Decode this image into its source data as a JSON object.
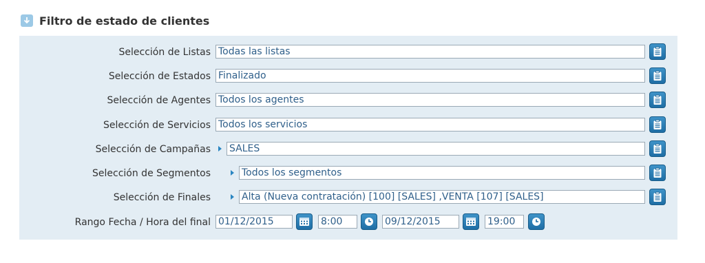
{
  "title": "Filtro de estado de clientes",
  "rows": [
    {
      "label": "Selección de Listas",
      "value": "Todas las listas"
    },
    {
      "label": "Selección de Estados",
      "value": "Finalizado"
    },
    {
      "label": "Selección de Agentes",
      "value": "Todos los agentes"
    },
    {
      "label": "Selección de Servicios",
      "value": "Todos los servicios"
    },
    {
      "label": "Selección de Campañas",
      "value": "SALES"
    },
    {
      "label": "Selección de Segmentos",
      "value": "Todos los segmentos"
    },
    {
      "label": "Selección de Finales",
      "value": "Alta (Nueva contratación) [100]  [SALES] ,VENTA [107]  [SALES]"
    }
  ],
  "date_range": {
    "label": "Rango Fecha / Hora del final",
    "start_date": "01/12/2015",
    "start_time": "8:00",
    "end_date": "09/12/2015",
    "end_time": "19:00"
  },
  "colors": {
    "panel_bg": "#e3edf4",
    "button_blue": "#1f6ea5",
    "field_text": "#2f5f8a"
  }
}
